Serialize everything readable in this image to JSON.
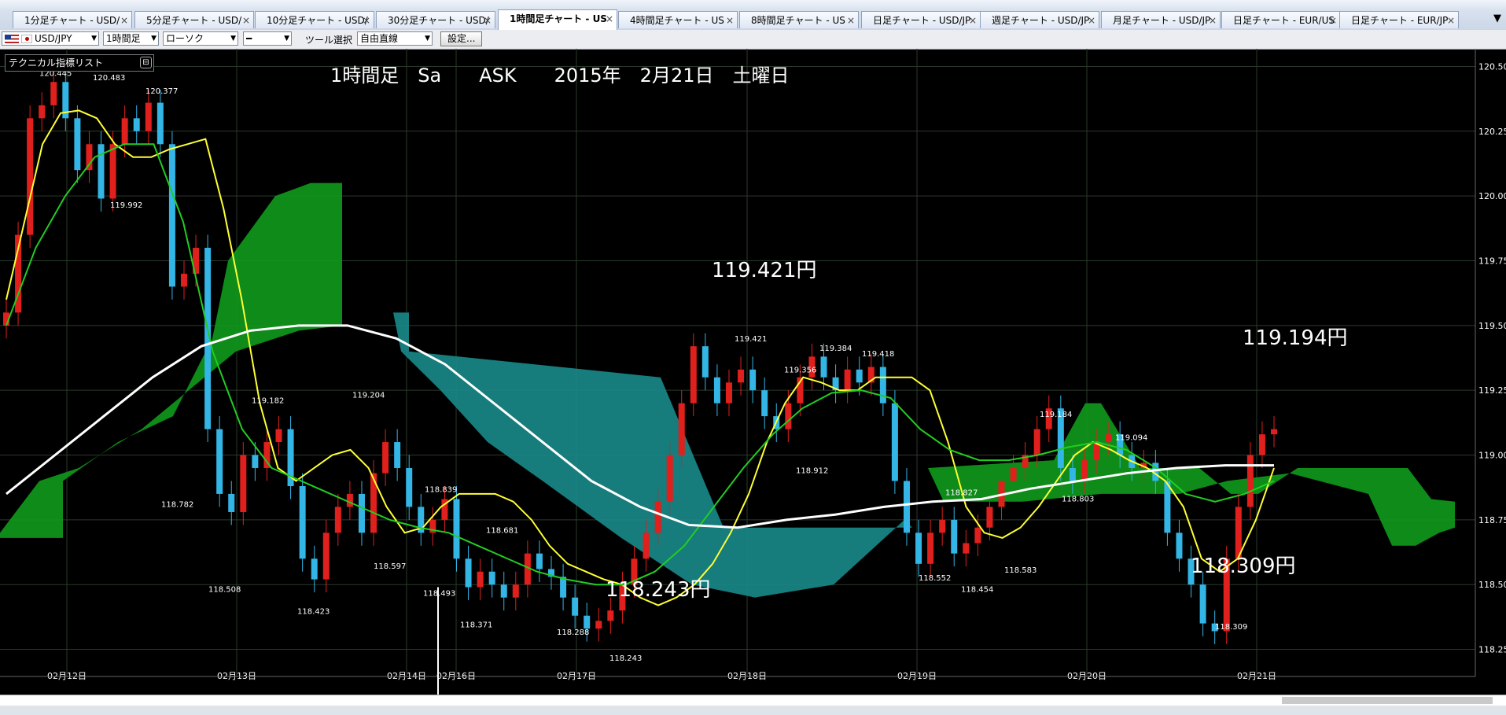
{
  "tabs": [
    {
      "label": "1分足チャート - USD/",
      "active": false
    },
    {
      "label": "5分足チャート - USD/",
      "active": false
    },
    {
      "label": "10分足チャート - USD/",
      "active": false
    },
    {
      "label": "30分足チャート - USD/",
      "active": false
    },
    {
      "label": "1時間足チャート - US",
      "active": true
    },
    {
      "label": "4時間足チャート - US",
      "active": false
    },
    {
      "label": "8時間足チャート - US",
      "active": false
    },
    {
      "label": "日足チャート - USD/JP",
      "active": false
    },
    {
      "label": "週足チャート - USD/JP",
      "active": false
    },
    {
      "label": "月足チャート - USD/JP",
      "active": false
    },
    {
      "label": "日足チャート - EUR/US",
      "active": false
    },
    {
      "label": "日足チャート - EUR/JP",
      "active": false
    }
  ],
  "tab_close_glyph": "×",
  "tab_menu_glyph": "▼",
  "toolbar": {
    "pair": "USD/JPY",
    "timeframe": "1時間足",
    "chart_type": "ローソク",
    "line_style": "━",
    "tool_label": "ツール選択",
    "tool_value": "自由直線",
    "settings_button": "設定..."
  },
  "indicator_list_label": "テクニカル指標リスト",
  "colors": {
    "candle_up": "#e0201c",
    "candle_down": "#33b5e5",
    "cloud_bull": "#0f9a1c",
    "cloud_bear": "#1a8a8a",
    "sma_short": "#ffff33",
    "sma_mid": "#22cc22",
    "sma_long": "#ffffff",
    "grid": "#2a3a2a"
  },
  "chart_data": {
    "type": "line",
    "title": "1時間足　Sa　　ASK　　2015年　2月21日　土曜日",
    "ylim": [
      118.2,
      120.55
    ],
    "y_ticks": [
      "120.50",
      "120.25",
      "120.00",
      "119.75",
      "119.50",
      "119.25",
      "119.00",
      "118.75",
      "118.50",
      "118.25"
    ],
    "x_ticks": [
      "02月12日",
      "02月13日",
      "02月14日",
      "02月16日",
      "02月17日",
      "02月18日",
      "02月19日",
      "02月20日",
      "02月21日"
    ],
    "series": [
      {
        "name": "close",
        "values": [
          119.55,
          119.85,
          120.3,
          120.35,
          120.44,
          120.3,
          120.1,
          120.2,
          119.99,
          120.2,
          120.3,
          120.25,
          120.36,
          120.2,
          119.65,
          119.7,
          119.8,
          119.1,
          118.85,
          118.78,
          119.0,
          118.95,
          119.05,
          119.1,
          118.88,
          118.6,
          118.52,
          118.7,
          118.8,
          118.85,
          118.7,
          118.93,
          119.05,
          118.95,
          118.8,
          118.7,
          118.75,
          118.83,
          118.6,
          118.49,
          118.55,
          118.5,
          118.45,
          118.5,
          118.62,
          118.56,
          118.53,
          118.45,
          118.38,
          118.33,
          118.36,
          118.4,
          118.5,
          118.6,
          118.7,
          118.82,
          119.0,
          119.2,
          119.42,
          119.3,
          119.2,
          119.28,
          119.33,
          119.25,
          119.15,
          119.1,
          119.2,
          119.3,
          119.38,
          119.3,
          119.25,
          119.33,
          119.28,
          119.34,
          119.2,
          118.9,
          118.7,
          118.58,
          118.7,
          118.75,
          118.62,
          118.66,
          118.72,
          118.8,
          118.9,
          118.95,
          119.0,
          119.1,
          119.18,
          118.95,
          118.9,
          118.98,
          119.05,
          119.08,
          119.0,
          118.95,
          118.97,
          118.9,
          118.7,
          118.6,
          118.5,
          118.35,
          118.32,
          118.6,
          118.8,
          119.0,
          119.08,
          119.1
        ]
      },
      {
        "name": "MA short",
        "values": [
          119.6,
          119.9,
          120.2,
          120.32,
          120.33,
          120.3,
          120.2,
          120.15,
          120.15,
          120.18,
          120.2,
          120.22,
          119.95,
          119.6,
          119.2,
          118.95,
          118.9,
          118.95,
          119.0,
          119.02,
          118.95,
          118.8,
          118.7,
          118.72,
          118.8,
          118.85,
          118.85,
          118.85,
          118.82,
          118.75,
          118.65,
          118.58,
          118.55,
          118.52,
          118.5,
          118.45,
          118.42,
          118.45,
          118.5,
          118.58,
          118.7,
          118.85,
          119.05,
          119.2,
          119.3,
          119.28,
          119.25,
          119.25,
          119.3,
          119.3,
          119.3,
          119.25,
          119.05,
          118.8,
          118.7,
          118.68,
          118.72,
          118.8,
          118.9,
          119.0,
          119.05,
          119.02,
          118.98,
          118.95,
          118.9,
          118.8,
          118.6,
          118.55,
          118.6,
          118.75,
          118.95
        ]
      },
      {
        "name": "MA mid",
        "values": [
          119.5,
          119.8,
          120.0,
          120.15,
          120.2,
          120.2,
          119.9,
          119.4,
          119.1,
          118.95,
          118.9,
          118.85,
          118.8,
          118.75,
          118.72,
          118.7,
          118.65,
          118.6,
          118.55,
          118.52,
          118.5,
          118.5,
          118.55,
          118.65,
          118.8,
          118.95,
          119.08,
          119.18,
          119.24,
          119.25,
          119.22,
          119.1,
          119.02,
          118.98,
          118.98,
          119.0,
          119.03,
          119.05,
          119.02,
          118.95,
          118.85,
          118.82,
          118.85,
          118.9
        ]
      },
      {
        "name": "MA long",
        "values": [
          118.85,
          119.0,
          119.15,
          119.3,
          119.42,
          119.48,
          119.5,
          119.5,
          119.45,
          119.35,
          119.2,
          119.05,
          118.9,
          118.8,
          118.73,
          118.72,
          118.75,
          118.77,
          118.8,
          118.82,
          118.83,
          118.87,
          118.9,
          118.93,
          118.95,
          118.96,
          118.96
        ]
      }
    ],
    "annotations": [
      "120.445",
      "120.483",
      "120.377",
      "119.992",
      "118.782",
      "118.508",
      "119.182",
      "118.423",
      "119.204",
      "118.597",
      "118.839",
      "118.493",
      "118.681",
      "118.371",
      "118.288",
      "118.243",
      "119.421",
      "119.356",
      "119.384",
      "119.418",
      "118.912",
      "119.184",
      "118.827",
      "118.552",
      "118.454",
      "118.583",
      "118.803",
      "119.094",
      "118.309"
    ],
    "big_labels": [
      "119.421円",
      "119.194円",
      "118.243円",
      "118.309円"
    ]
  }
}
